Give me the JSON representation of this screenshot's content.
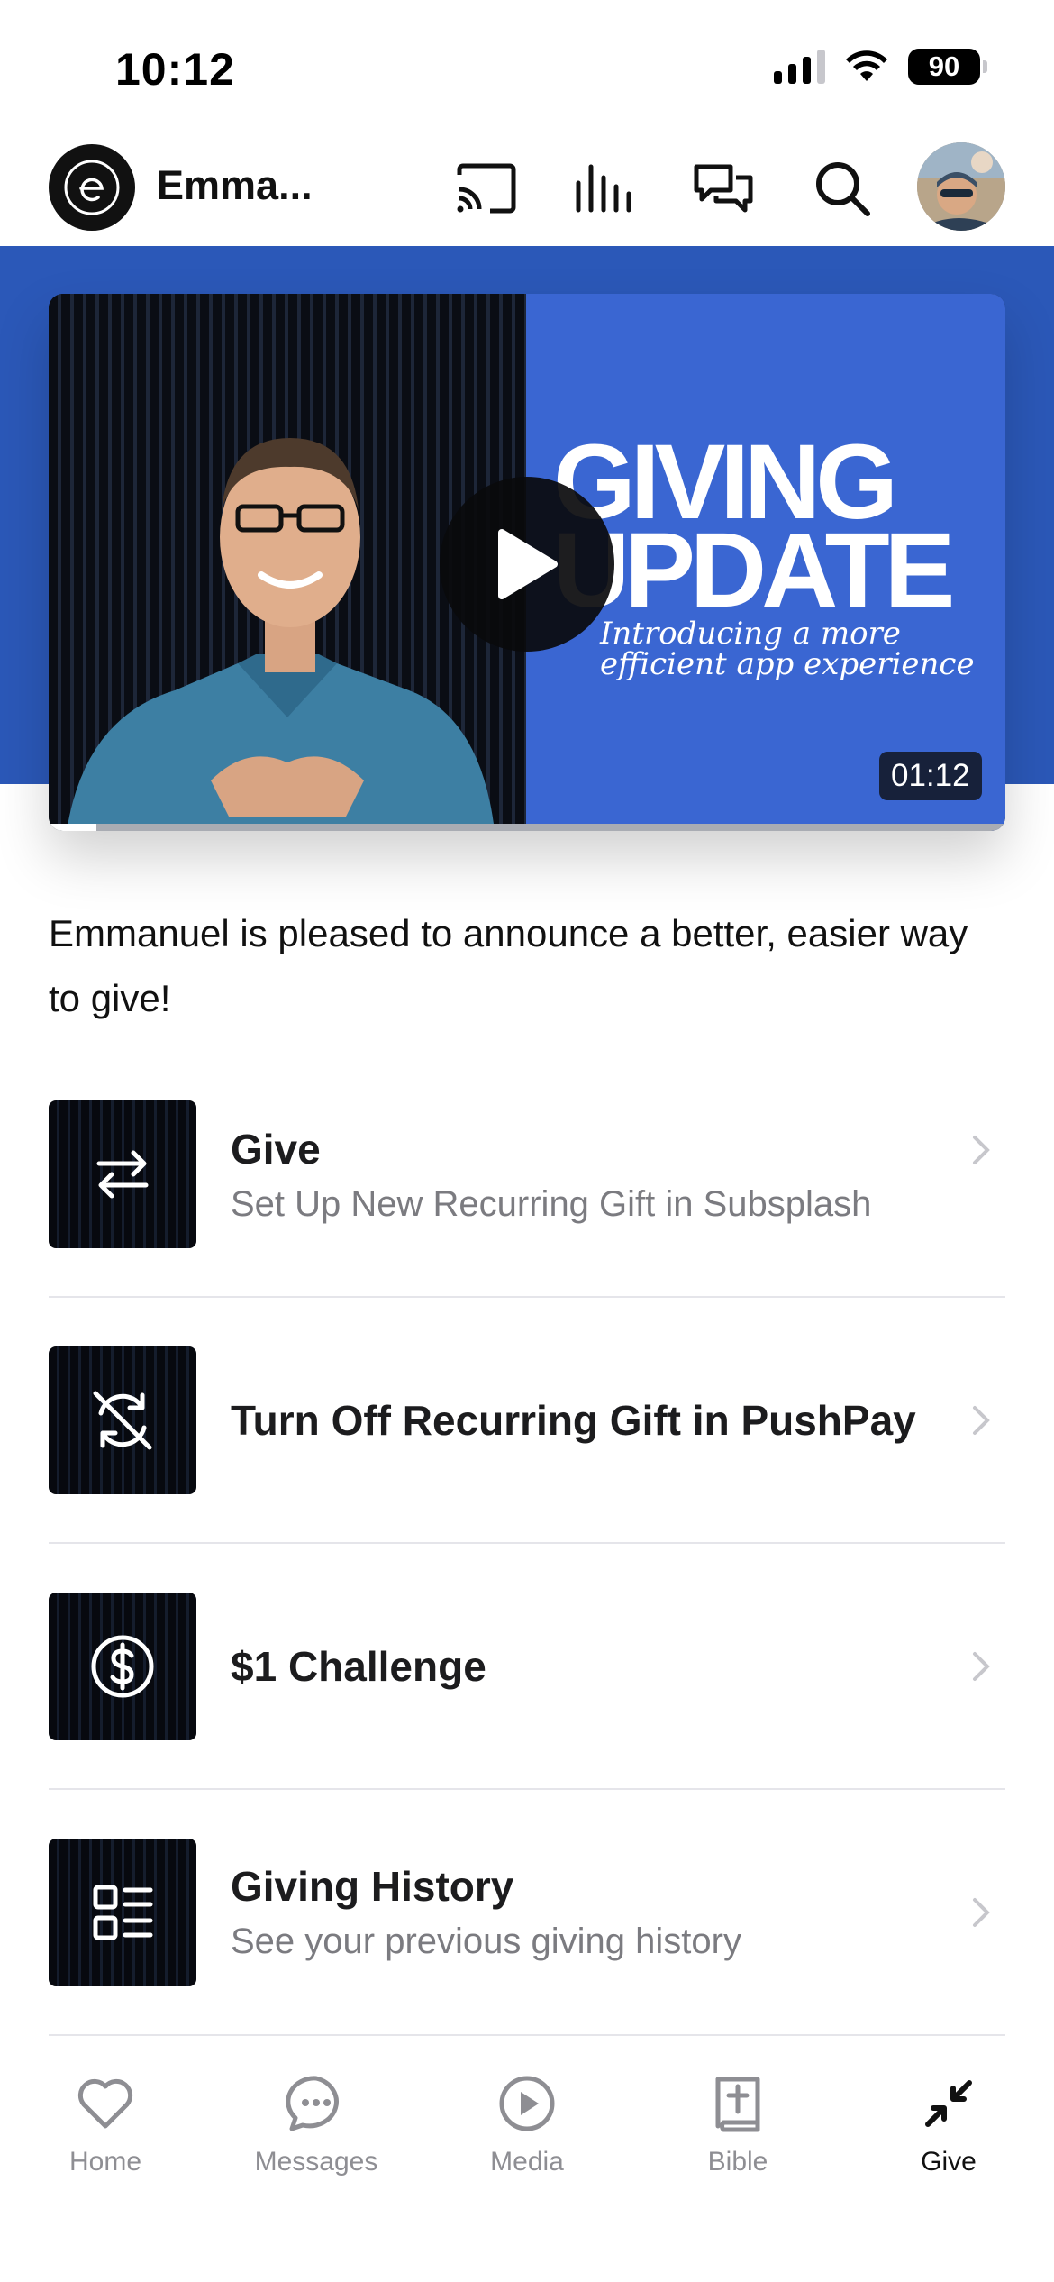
{
  "status_bar": {
    "time": "10:12",
    "battery": "90"
  },
  "header": {
    "title": "Emma...",
    "icons": [
      "cast-icon",
      "audio-bars-icon",
      "chat-bubbles-icon",
      "search-icon"
    ],
    "avatar": "profile-avatar"
  },
  "video": {
    "title_line1": "GIVING",
    "title_line2": "UPDATE",
    "subtitle": "Introducing a more efficient app experience",
    "duration": "01:12",
    "progress": 0.05
  },
  "description": "Emmanuel is pleased to announce a better, easier way to give!",
  "list": [
    {
      "title": "Give",
      "subtitle": "Set Up New Recurring Gift in Subsplash",
      "icon": "swap-arrows-icon"
    },
    {
      "title": "Turn Off Recurring Gift in PushPay",
      "subtitle": "",
      "icon": "recurring-off-icon"
    },
    {
      "title": "$1 Challenge",
      "subtitle": "",
      "icon": "dollar-circle-icon"
    },
    {
      "title": "Giving History",
      "subtitle": "See your previous giving history",
      "icon": "list-icon"
    }
  ],
  "tabs": [
    {
      "label": "Home",
      "icon": "heart-icon"
    },
    {
      "label": "Messages",
      "icon": "chat-icon"
    },
    {
      "label": "Media",
      "icon": "play-circle-icon"
    },
    {
      "label": "Bible",
      "icon": "bible-icon"
    },
    {
      "label": "Give",
      "icon": "collapse-arrows-icon",
      "active": true
    }
  ],
  "colors": {
    "hero_blue": "#2b58b8",
    "card_blue": "#3a66d2",
    "tab_inactive": "#8e8e93",
    "text_dark": "#1c1c1e"
  }
}
